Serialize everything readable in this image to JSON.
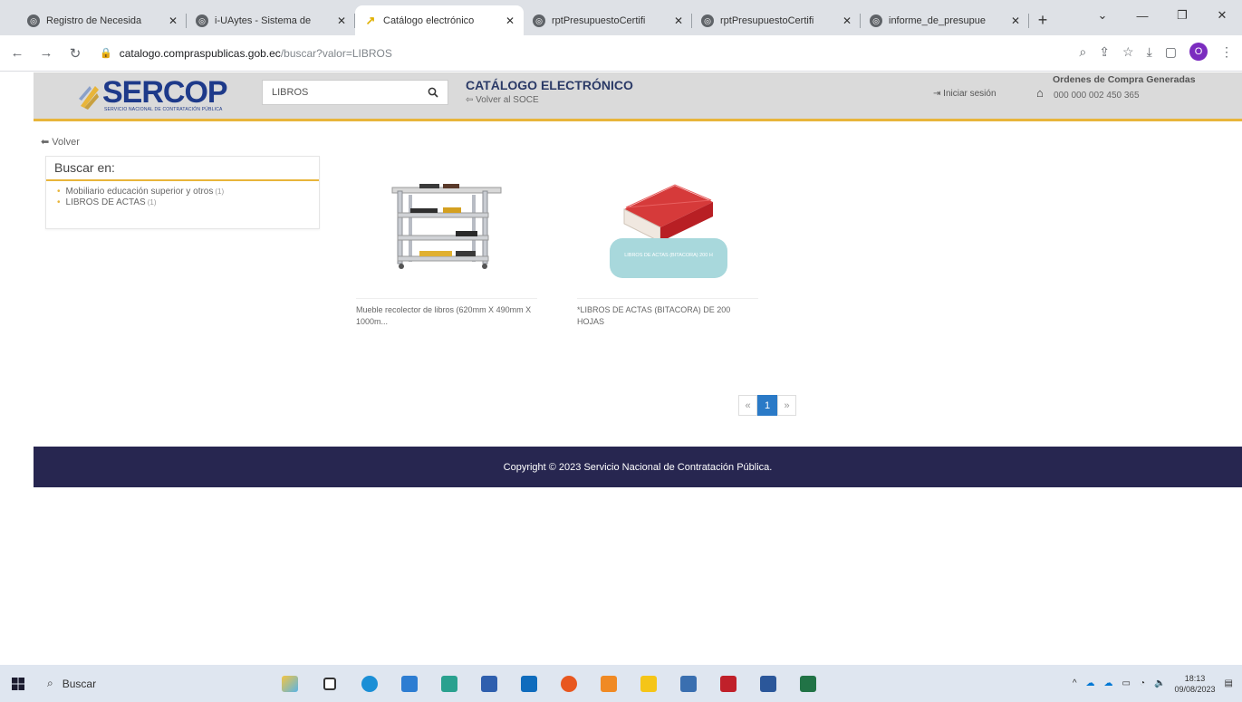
{
  "browser": {
    "tabs": [
      {
        "title": "Registro de Necesida",
        "active": false
      },
      {
        "title": "i-UAytes - Sistema de",
        "active": false
      },
      {
        "title": "Catálogo electrónico",
        "active": true
      },
      {
        "title": "rptPresupuestoCertifi",
        "active": false
      },
      {
        "title": "rptPresupuestoCertifi",
        "active": false
      },
      {
        "title": "informe_de_presupue",
        "active": false
      }
    ],
    "new_tab": "+",
    "url_domain": "catalogo.compraspublicas.gob.ec",
    "url_path": "/buscar?valor=LIBROS",
    "profile_initial": "O"
  },
  "header": {
    "logo_text": "SERCOP",
    "logo_subtitle": "SERVICIO NACIONAL DE CONTRATACIÓN PÚBLICA",
    "search_value": "LIBROS",
    "catalog_title": "CATÁLOGO ELECTRÓNICO",
    "back_to_soce": "Volver al SOCE",
    "login": "Iniciar sesión",
    "orders_title": "Ordenes de Compra Generadas",
    "orders_count": "000 000 002 450 365"
  },
  "content": {
    "back_link": "Volver",
    "filter_title": "Buscar en:",
    "filters": [
      {
        "label": "Mobiliario educación superior y otros",
        "count": "(1)"
      },
      {
        "label": "LIBROS DE ACTAS",
        "count": "(1)"
      }
    ],
    "products": [
      {
        "name": "Mueble recolector de libros (620mm X 490mm X 1000m..."
      },
      {
        "name": "*LIBROS DE ACTAS (BITACORA) DE 200 HOJAS",
        "badge": "LIBROS DE ACTAS (BITACORA) 200 H"
      }
    ],
    "pagination": {
      "prev": "«",
      "current": "1",
      "next": "»"
    }
  },
  "footer": {
    "copyright": "Copyright © 2023 Servicio Nacional de Contratación Pública."
  },
  "taskbar": {
    "search_label": "Buscar",
    "time": "18:13",
    "date": "09/08/2023"
  },
  "colors": {
    "header_bg": "#dadada",
    "accent": "#e8b53a",
    "footer_bg": "#272650",
    "logo_blue": "#1e3a8a",
    "pager_active": "#2a7ac7"
  }
}
